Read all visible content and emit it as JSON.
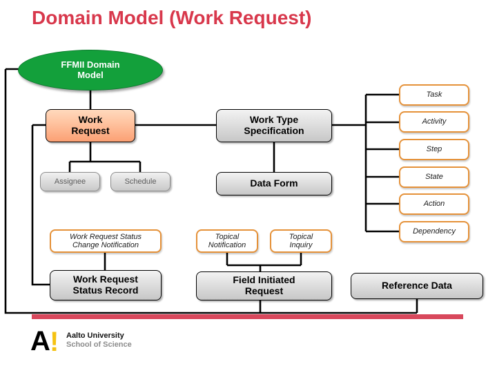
{
  "slide": {
    "title": "Domain Model (Work Request)"
  },
  "root": {
    "label": "FFMII Domain\nModel",
    "line1": "FFMII Domain",
    "line2": "Model",
    "color": "#13A03B"
  },
  "nodes": {
    "work_request": {
      "line1": "Work",
      "line2": "Request",
      "color": "#FBA074"
    },
    "work_type_specification": {
      "line1": "Work Type",
      "line2": "Specification",
      "color": "#C7C7C7"
    },
    "assignee": {
      "label": "Assignee",
      "color": "#C9C9C9"
    },
    "schedule": {
      "label": "Schedule",
      "color": "#C9C9C9"
    },
    "data_form": {
      "label": "Data Form",
      "color": "#C7C7C7"
    },
    "wr_status_change_notification": {
      "line1": "Work Request Status",
      "line2": "Change Notification",
      "color": "#E59138"
    },
    "wr_status_record": {
      "line1": "Work Request",
      "line2": "Status Record",
      "color": "#C7C7C7"
    },
    "topical_notification": {
      "line1": "Topical",
      "line2": "Notification",
      "color": "#E59138"
    },
    "topical_inquiry": {
      "line1": "Topical",
      "line2": "Inquiry",
      "color": "#E59138"
    },
    "field_initiated_request": {
      "line1": "Field Initiated",
      "line2": "Request",
      "color": "#C7C7C7"
    },
    "reference_data": {
      "label": "Reference Data",
      "color": "#C7C7C7"
    }
  },
  "right_column": {
    "items": [
      {
        "label": "Task"
      },
      {
        "label": "Activity"
      },
      {
        "label": "Step"
      },
      {
        "label": "State"
      },
      {
        "label": "Action"
      },
      {
        "label": "Dependency"
      }
    ],
    "color": "#E59138"
  },
  "footer": {
    "bar_color": "#D8485C",
    "logo_letter": "A",
    "logo_mark": "!",
    "org_line1": "Aalto University",
    "org_line2": "School of Science"
  }
}
